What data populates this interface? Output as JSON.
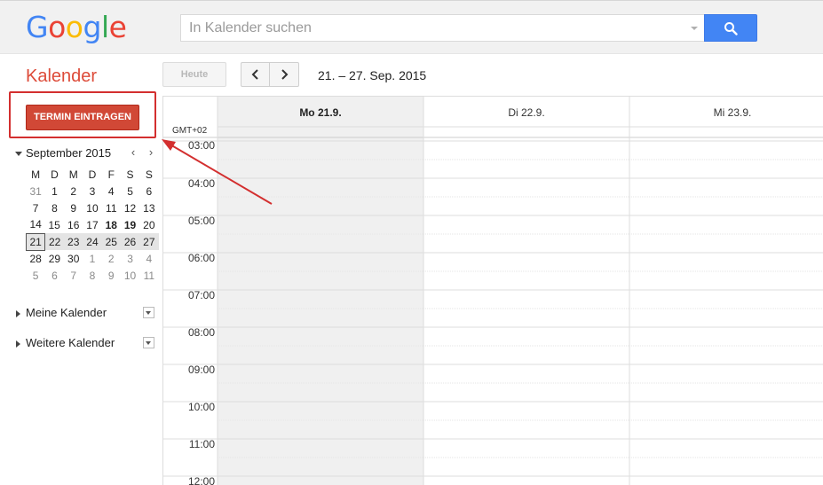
{
  "header": {
    "logo_letters": [
      {
        "ch": "G",
        "color": "#4285f4"
      },
      {
        "ch": "o",
        "color": "#ea4335"
      },
      {
        "ch": "o",
        "color": "#fbbc05"
      },
      {
        "ch": "g",
        "color": "#4285f4"
      },
      {
        "ch": "l",
        "color": "#34a853"
      },
      {
        "ch": "e",
        "color": "#ea4335"
      }
    ],
    "search_placeholder": "In Kalender suchen",
    "search_icon": "search-icon"
  },
  "app": {
    "title": "Kalender"
  },
  "toolbar": {
    "today_label": "Heute",
    "prev_icon": "chevron-left-icon",
    "next_icon": "chevron-right-icon",
    "date_range": "21. – 27. Sep. 2015"
  },
  "create_button": {
    "label": "TERMIN EINTRAGEN"
  },
  "mini_calendar": {
    "title": "September 2015",
    "prev": "‹",
    "next": "›",
    "weekdays": [
      "M",
      "D",
      "M",
      "D",
      "F",
      "S",
      "S"
    ],
    "weeks": [
      [
        "31",
        "1",
        "2",
        "3",
        "4",
        "5",
        "6"
      ],
      [
        "7",
        "8",
        "9",
        "10",
        "11",
        "12",
        "13"
      ],
      [
        "14",
        "15",
        "16",
        "17",
        "18",
        "19",
        "20"
      ],
      [
        "21",
        "22",
        "23",
        "24",
        "25",
        "26",
        "27"
      ],
      [
        "28",
        "29",
        "30",
        "1",
        "2",
        "3",
        "4"
      ],
      [
        "5",
        "6",
        "7",
        "8",
        "9",
        "10",
        "11"
      ]
    ]
  },
  "sections": [
    {
      "label": "Meine Kalender"
    },
    {
      "label": "Weitere Kalender"
    }
  ],
  "grid": {
    "timezone": "GMT+02",
    "days": [
      "Mo 21.9.",
      "Di 22.9.",
      "Mi 23.9."
    ],
    "hours": [
      "03:00",
      "04:00",
      "05:00",
      "06:00",
      "07:00",
      "08:00",
      "09:00",
      "10:00",
      "11:00",
      "12:00"
    ]
  },
  "colors": {
    "accent_red": "#d14836",
    "title_red": "#dd4b39",
    "search_blue": "#4285f4",
    "annotation_red": "#d32f2f"
  }
}
